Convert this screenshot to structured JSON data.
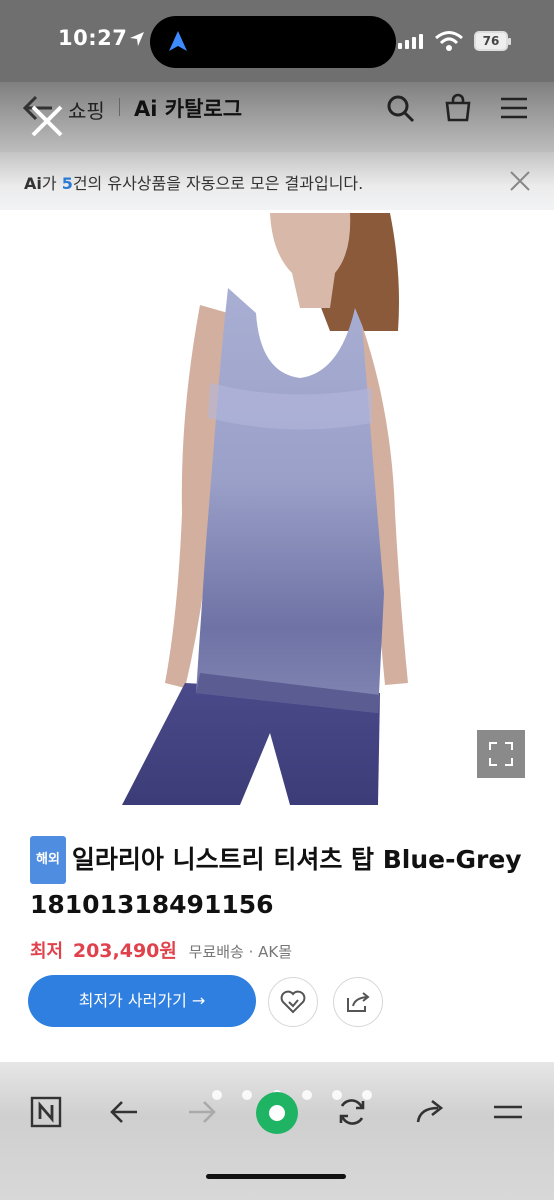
{
  "status_bar": {
    "time": "10:27",
    "battery": "76"
  },
  "header": {
    "back_label": "",
    "crumb_shop": "쇼핑",
    "crumb_title": "Ai 카탈로그"
  },
  "banner": {
    "prefix": "Ai",
    "mid1": "가 ",
    "count": "5",
    "suffix": "건의 유사상품을 자동으로 모은 결과입니다."
  },
  "product": {
    "badge": "해외",
    "title": "일라리아 니스트리 티셔츠 탑 Blue-Grey 18101318491156",
    "price_label": "최저",
    "price": "203,490원",
    "shipping": "무료배송 · AK몰",
    "buy_button": "최저가 사러가기 →"
  },
  "colors": {
    "accent": "#2f7fe0",
    "price": "#e0424d",
    "naver_green": "#1fb364"
  },
  "icons": [
    "back-icon",
    "close-icon",
    "search-icon",
    "shopping-bag-icon",
    "menu-icon",
    "expand-icon",
    "like-icon",
    "share-icon",
    "naver-home-icon",
    "arrow-left-icon",
    "arrow-right-icon",
    "green-dot-icon",
    "refresh-icon",
    "share-arrow-icon",
    "hamburger-icon"
  ]
}
